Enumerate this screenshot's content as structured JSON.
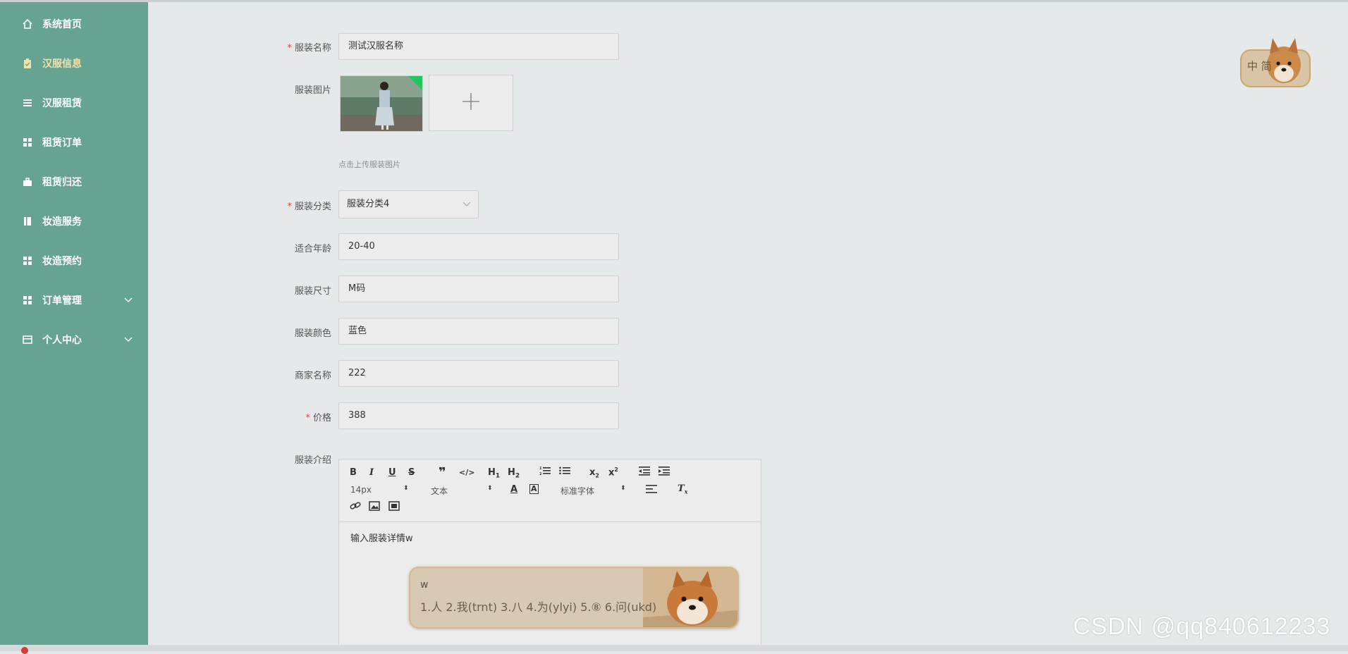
{
  "sidebar": {
    "items": [
      {
        "label": "系统首页",
        "icon": "home-icon"
      },
      {
        "label": "汉服信息",
        "icon": "clipboard-icon",
        "active": true
      },
      {
        "label": "汉服租赁",
        "icon": "list-icon"
      },
      {
        "label": "租赁订单",
        "icon": "grid-icon"
      },
      {
        "label": "租赁归还",
        "icon": "briefcase-icon"
      },
      {
        "label": "妆造服务",
        "icon": "book-icon"
      },
      {
        "label": "妆造预约",
        "icon": "grid-icon"
      },
      {
        "label": "订单管理",
        "icon": "grid-icon",
        "expandable": true
      },
      {
        "label": "个人中心",
        "icon": "card-icon",
        "expandable": true
      }
    ],
    "colors": {
      "background": "#67a392",
      "active_text": "#f2e2a8"
    }
  },
  "form": {
    "name": {
      "label": "服装名称",
      "required": true,
      "value": "测试汉服名称"
    },
    "image": {
      "label": "服装图片",
      "hint": "点击上传服装图片"
    },
    "category": {
      "label": "服装分类",
      "required": true,
      "value": "服装分类4"
    },
    "age": {
      "label": "适合年龄",
      "value": "20-40"
    },
    "size": {
      "label": "服装尺寸",
      "value": "M码"
    },
    "color": {
      "label": "服装颜色",
      "value": "蓝色"
    },
    "merchant": {
      "label": "商家名称",
      "value": "222"
    },
    "price": {
      "label": "价格",
      "required": true,
      "value": "388"
    },
    "intro": {
      "label": "服装介绍",
      "font_size": "14px",
      "text_style": "文本",
      "font_family": "标准字体",
      "content": "输入服装详情w"
    }
  },
  "ime": {
    "composition": "w",
    "candidates": "1.人  2.我(trnt)  3.八  4.为(ylyi)  5.⑧  6.问(ukd)"
  },
  "corner_widget": {
    "text": "中 简"
  },
  "watermark": "CSDN @qq840612233"
}
